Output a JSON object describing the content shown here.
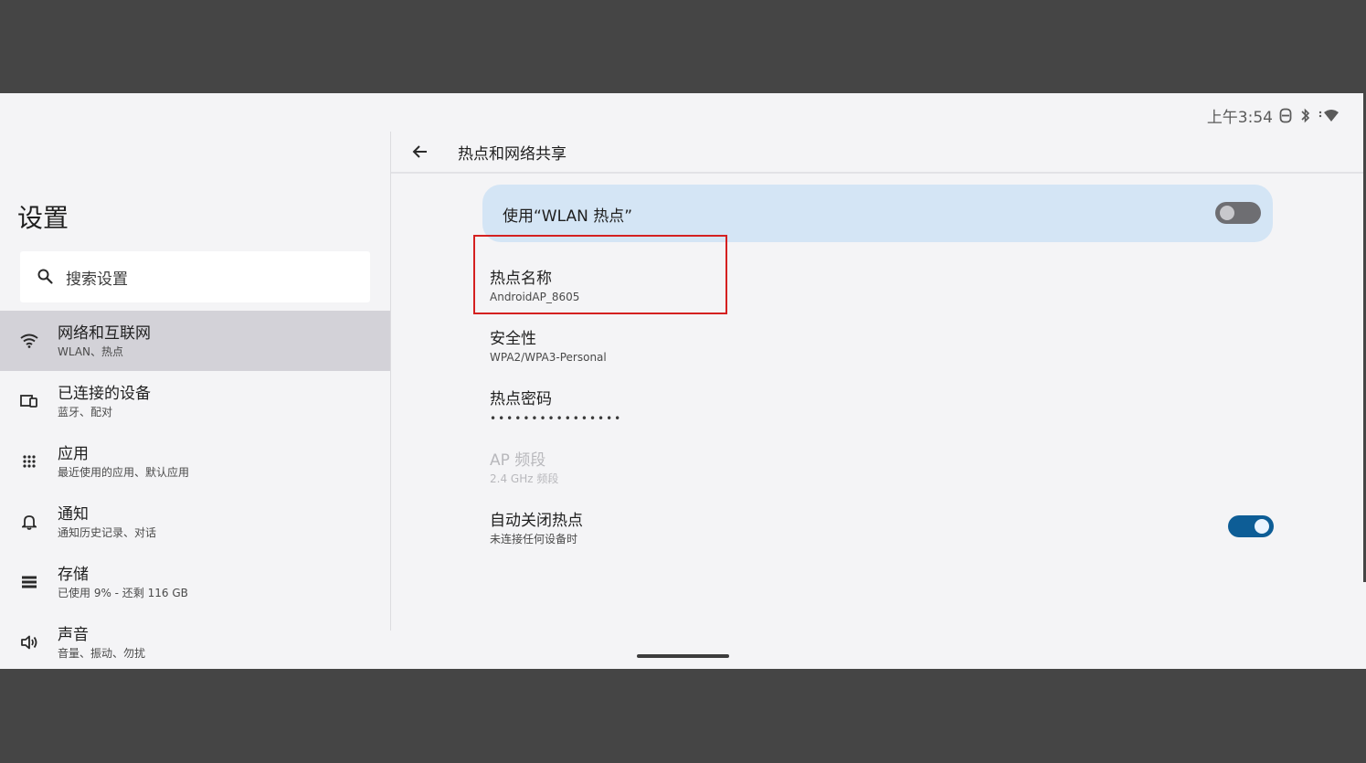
{
  "status_bar": {
    "time": "上午3:54",
    "icons": [
      "data-saver-icon",
      "bluetooth-icon",
      "wifi-signal-icon"
    ]
  },
  "sidebar": {
    "title": "设置",
    "search_placeholder": "搜索设置",
    "items": [
      {
        "title": "网络和互联网",
        "subtitle": "WLAN、热点",
        "icon": "wifi-icon",
        "active": true
      },
      {
        "title": "已连接的设备",
        "subtitle": "蓝牙、配对",
        "icon": "devices-icon",
        "active": false
      },
      {
        "title": "应用",
        "subtitle": "最近使用的应用、默认应用",
        "icon": "apps-grid-icon",
        "active": false
      },
      {
        "title": "通知",
        "subtitle": "通知历史记录、对话",
        "icon": "bell-icon",
        "active": false
      },
      {
        "title": "存储",
        "subtitle": "已使用 9% - 还剩 116 GB",
        "icon": "storage-icon",
        "active": false
      },
      {
        "title": "声音",
        "subtitle": "音量、振动、勿扰",
        "icon": "volume-icon",
        "active": false
      }
    ]
  },
  "detail": {
    "title": "热点和网络共享",
    "master_switch": {
      "label": "使用“WLAN 热点”",
      "on": false
    },
    "prefs": {
      "name": {
        "title": "热点名称",
        "subtitle": "AndroidAP_8605"
      },
      "security": {
        "title": "安全性",
        "subtitle": "WPA2/WPA3-Personal"
      },
      "password": {
        "title": "热点密码",
        "masked": "••••••••••••••••"
      },
      "band": {
        "title": "AP 频段",
        "subtitle": "2.4 GHz 频段",
        "enabled": false
      },
      "auto_off": {
        "title": "自动关闭热点",
        "subtitle": "未连接任何设备时",
        "on": true
      }
    }
  },
  "colors": {
    "screen_bg": "#f4f4f6",
    "frame_bg": "#454545",
    "active_nav": "#d3d2d8",
    "master_bg": "#d4e5f5",
    "toggle_on": "#0d5d96",
    "highlight": "#d42020"
  }
}
